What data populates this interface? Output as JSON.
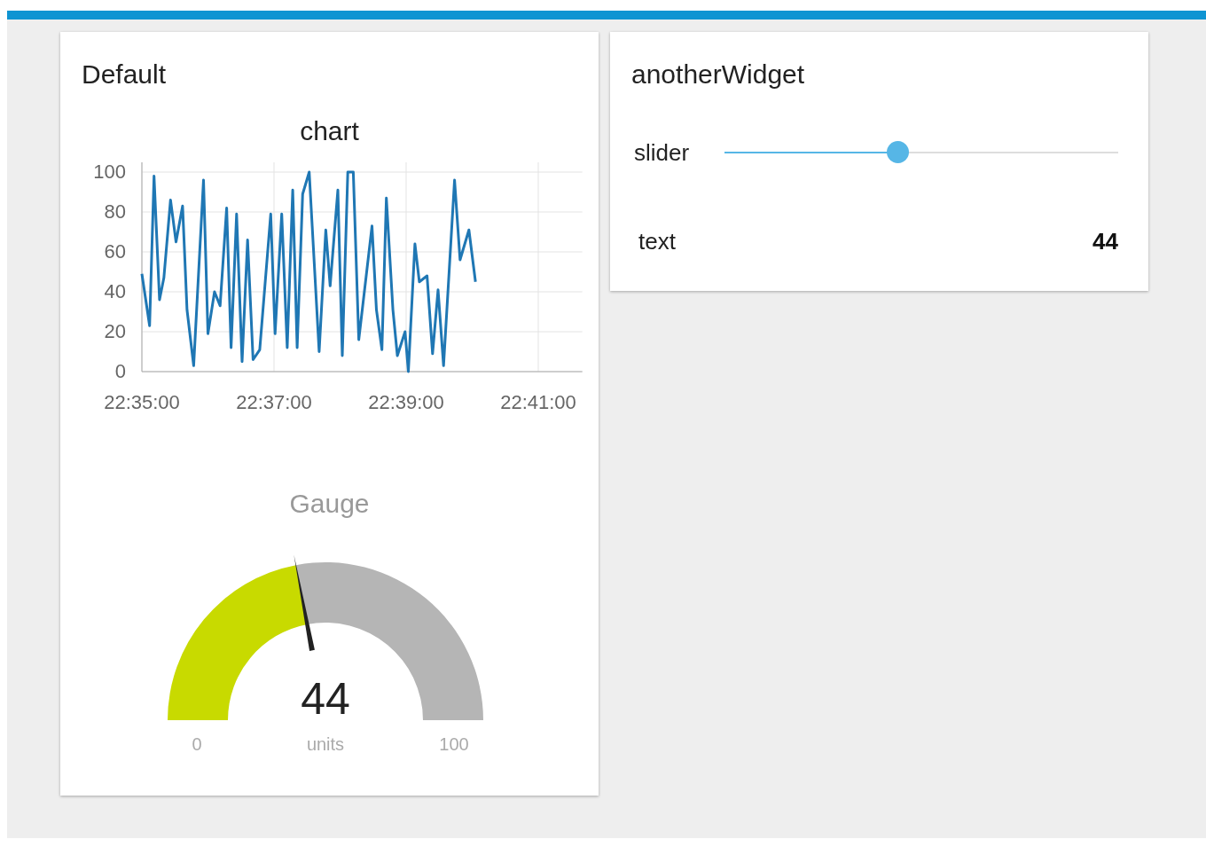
{
  "dashboard": {
    "groups": [
      {
        "title": "Default",
        "widgets": [
          {
            "kind": "chart",
            "title": "chart",
            "chart_data": {
              "type": "line",
              "x": [
                81300,
                81307,
                81311,
                81316,
                81320,
                81326,
                81331,
                81337,
                81341,
                81347,
                81356,
                81360,
                81366,
                81371,
                81377,
                81381,
                81386,
                81391,
                81396,
                81401,
                81407,
                81417,
                81421,
                81427,
                81432,
                81437,
                81441,
                81446,
                81452,
                81461,
                81467,
                81471,
                81478,
                81482,
                81487,
                81492,
                81497,
                81509,
                81513,
                81518,
                81522,
                81528,
                81532,
                81539,
                81542,
                81548,
                81552,
                81559,
                81564,
                81569,
                81574,
                81584,
                81589,
                81597,
                81603
              ],
              "series": [
                {
                  "color": "#1f77b4",
                  "values": [
                    49,
                    23,
                    98,
                    36,
                    47,
                    86,
                    65,
                    83,
                    31,
                    3,
                    96,
                    19,
                    40,
                    33,
                    82,
                    12,
                    79,
                    5,
                    66,
                    6,
                    11,
                    79,
                    19,
                    79,
                    12,
                    91,
                    12,
                    89,
                    100,
                    10,
                    71,
                    43,
                    91,
                    8,
                    100,
                    100,
                    16,
                    73,
                    31,
                    11,
                    87,
                    31,
                    8,
                    20,
                    0,
                    64,
                    45,
                    48,
                    9,
                    41,
                    3,
                    96,
                    56,
                    71,
                    45
                  ]
                }
              ],
              "xlim": [
                81300,
                81700
              ],
              "ylim": [
                0,
                100
              ],
              "grid": true,
              "xticks": [
                {
                  "value": 81300,
                  "label": "22:35:00"
                },
                {
                  "value": 81420,
                  "label": "22:37:00"
                },
                {
                  "value": 81540,
                  "label": "22:39:00"
                },
                {
                  "value": 81660,
                  "label": "22:41:00"
                }
              ],
              "yticks": [
                0,
                20,
                40,
                60,
                80,
                100
              ]
            }
          },
          {
            "kind": "gauge",
            "title": "Gauge",
            "value": "44",
            "level": 0.44,
            "min": "0",
            "units": "units",
            "max": "100"
          }
        ]
      },
      {
        "title": "anotherWidget",
        "widgets": [
          {
            "kind": "slider",
            "label": "slider",
            "level": 0.44
          },
          {
            "kind": "text",
            "label": "text",
            "value": "44"
          }
        ]
      }
    ]
  }
}
